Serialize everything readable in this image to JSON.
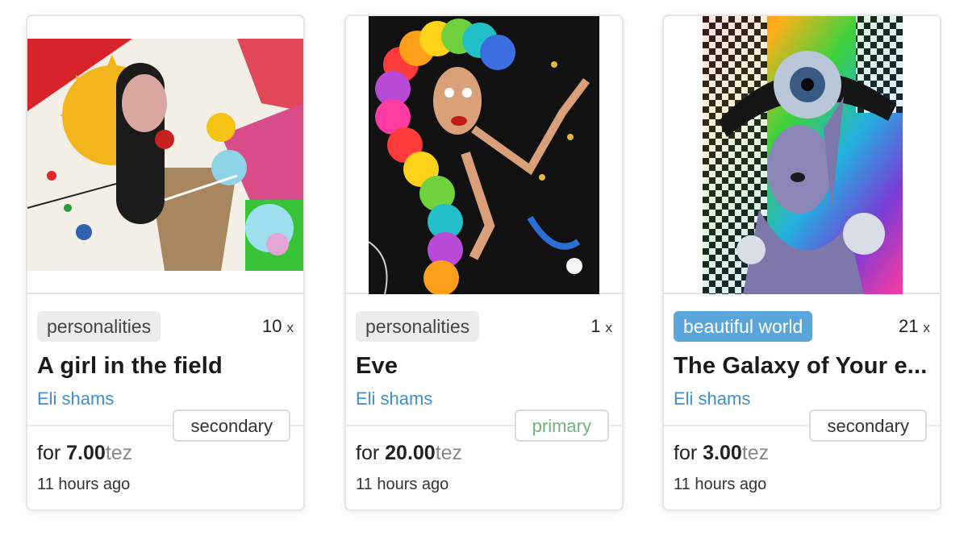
{
  "cards": [
    {
      "tag": "personalities",
      "edition": "10",
      "edition_suffix": "x",
      "title": "A girl in the field",
      "artist": "Eli shams",
      "market": "secondary",
      "price_prefix": "for",
      "price": "7.00",
      "currency": "tez",
      "time": "11 hours ago"
    },
    {
      "tag": "personalities",
      "edition": "1",
      "edition_suffix": "x",
      "title": "Eve",
      "artist": "Eli shams",
      "market": "primary",
      "price_prefix": "for",
      "price": "20.00",
      "currency": "tez",
      "time": "11 hours ago"
    },
    {
      "tag": "beautiful world",
      "edition": "21",
      "edition_suffix": "x",
      "title": "The Galaxy of Your e...",
      "artist": "Eli shams",
      "market": "secondary",
      "price_prefix": "for",
      "price": "3.00",
      "currency": "tez",
      "time": "11 hours ago"
    }
  ],
  "colors": {
    "tag_default": "#ececec",
    "tag_highlight": "#5aa5da",
    "artist_link": "#3d8fcf",
    "primary_label": "#6fb27a"
  }
}
